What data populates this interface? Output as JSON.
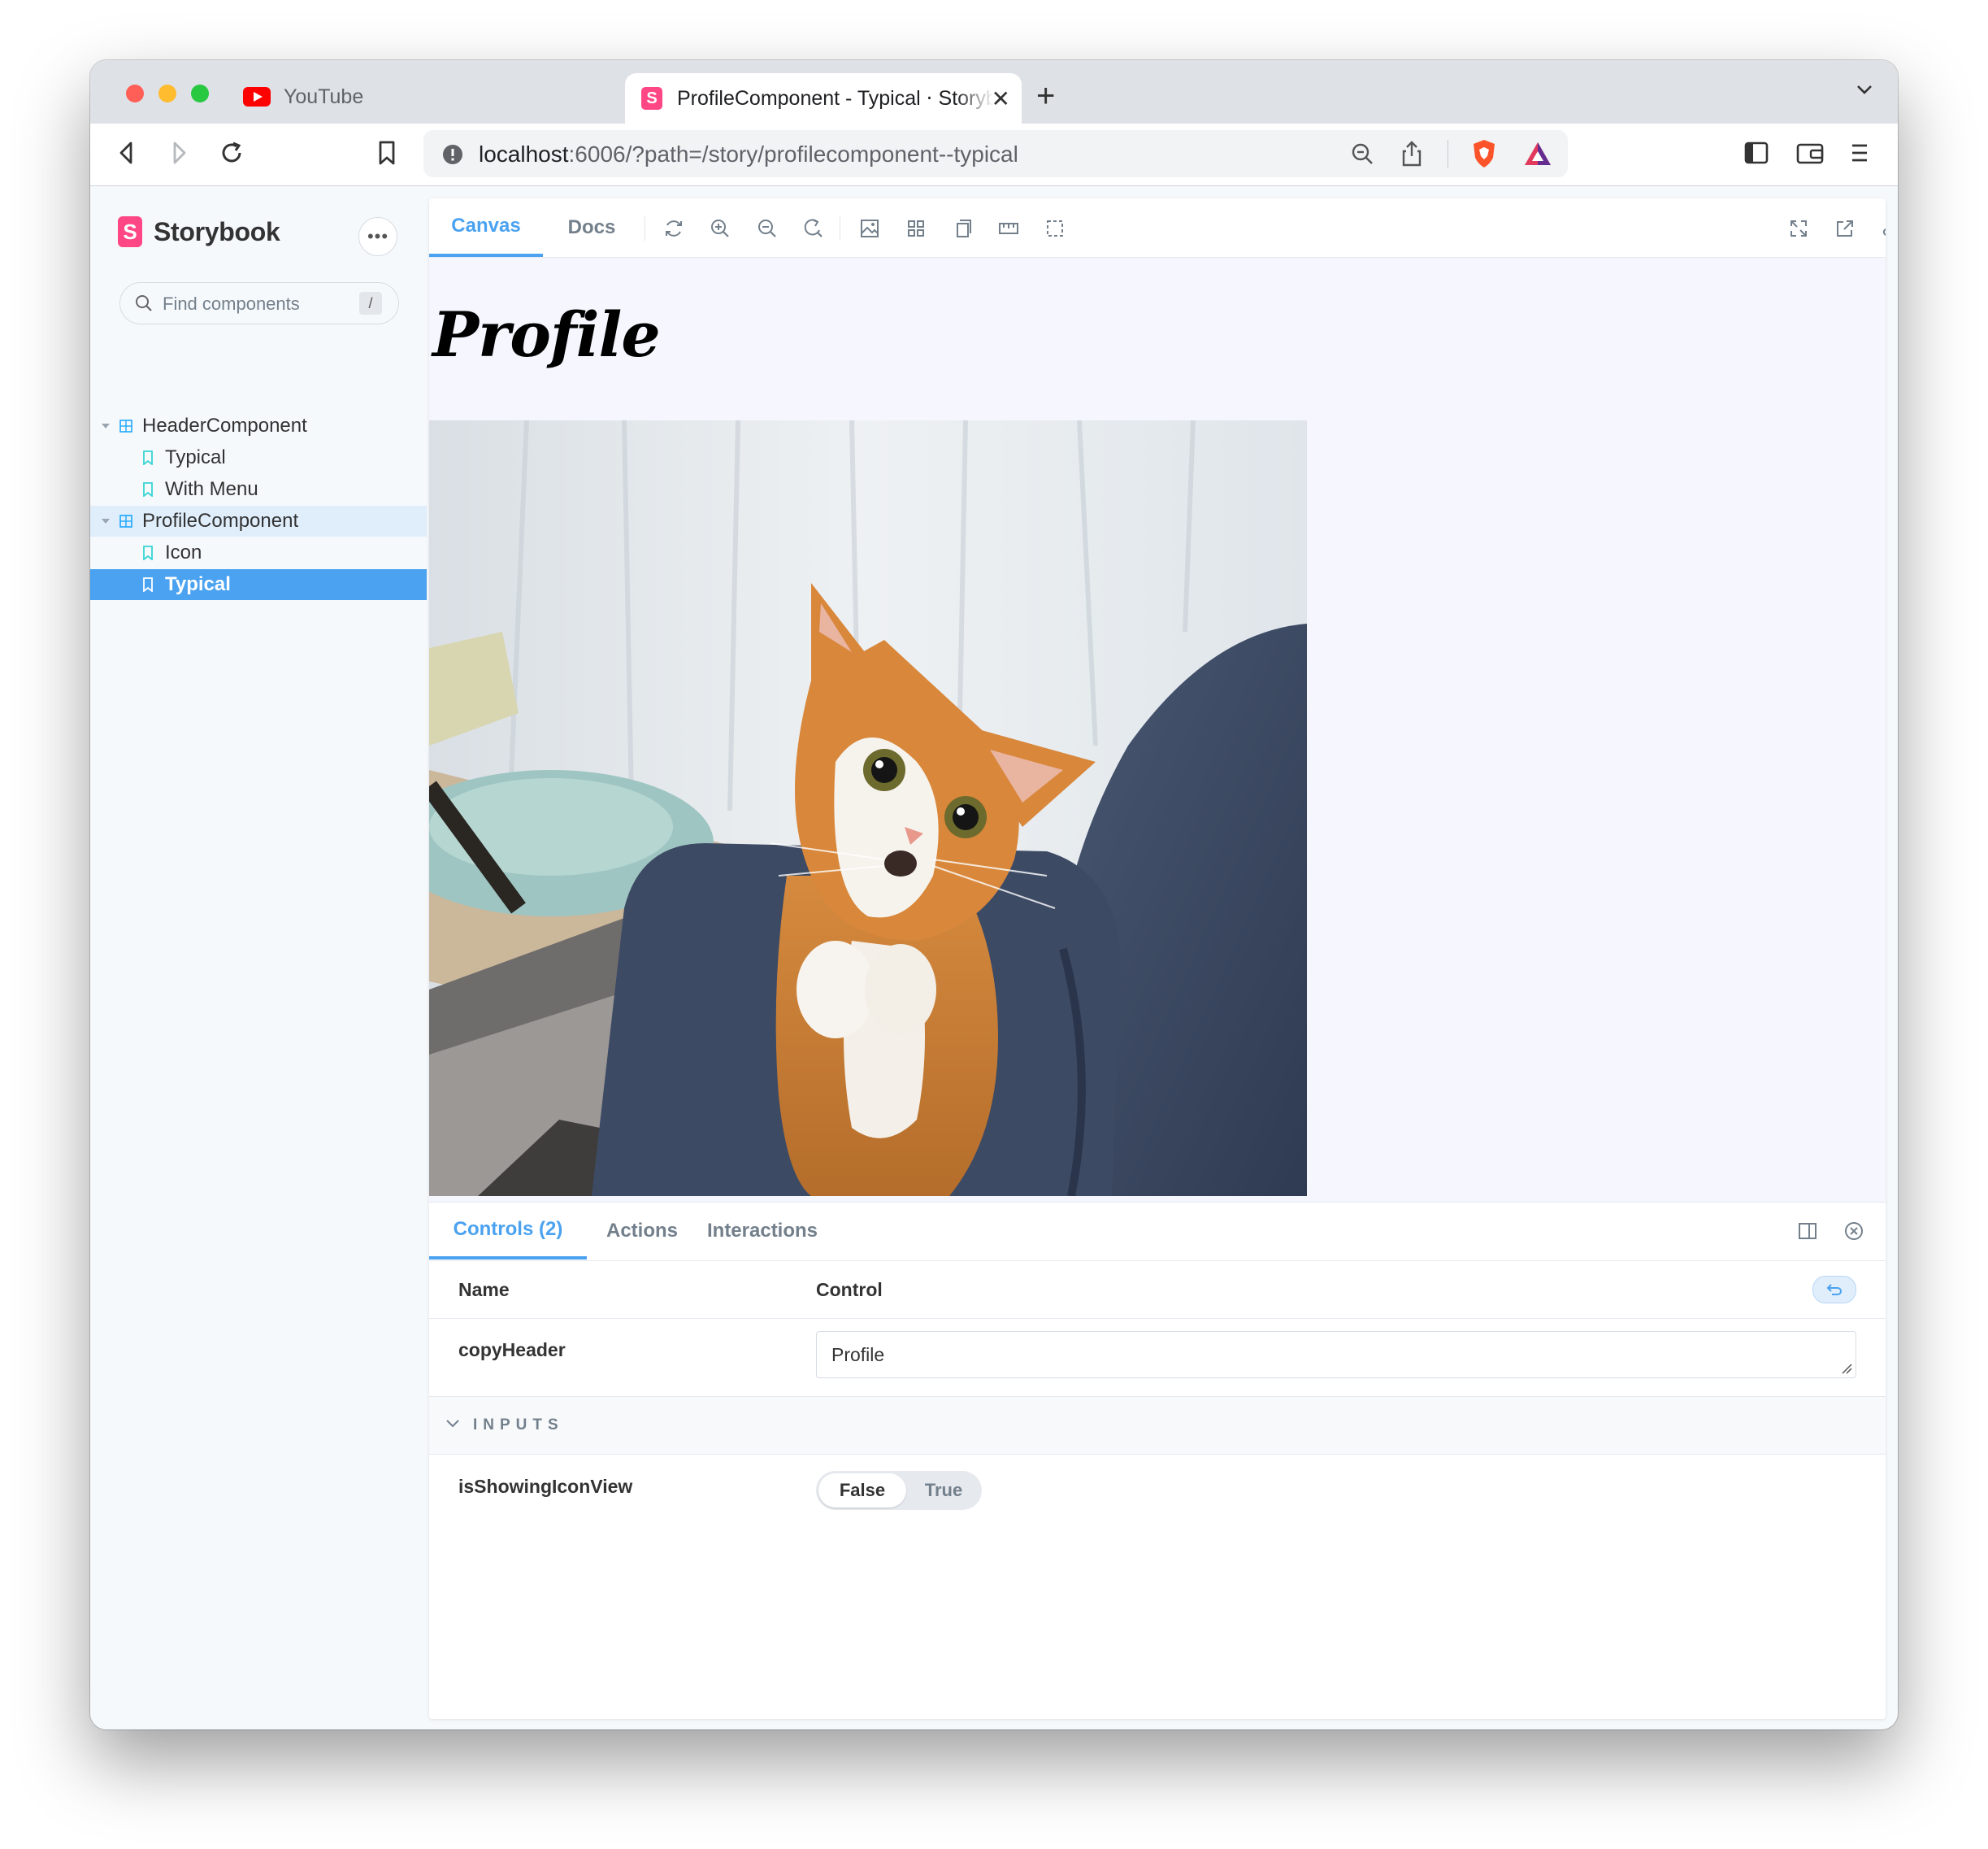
{
  "browser": {
    "tabs": [
      {
        "title": "YouTube",
        "active": false
      },
      {
        "title": "ProfileComponent - Typical ⋅ Storybook",
        "active": true
      }
    ],
    "url_host": "localhost",
    "url_rest": ":6006/?path=/story/profilecomponent--typical"
  },
  "sidebar": {
    "brand": "Storybook",
    "menu_glyph": "•••",
    "search_placeholder": "Find components",
    "search_shortcut": "/",
    "tree": [
      {
        "type": "component",
        "label": "HeaderComponent"
      },
      {
        "type": "story",
        "label": "Typical"
      },
      {
        "type": "story",
        "label": "With Menu"
      },
      {
        "type": "component",
        "label": "ProfileComponent"
      },
      {
        "type": "story",
        "label": "Icon"
      },
      {
        "type": "story",
        "label": "Typical"
      }
    ],
    "selected_story": "Typical"
  },
  "main": {
    "tabs": [
      "Canvas",
      "Docs"
    ],
    "active_tab": "Canvas",
    "preview": {
      "heading": "Profile",
      "image": "orange-white-cat-photo"
    }
  },
  "addons": {
    "tabs": [
      "Controls (2)",
      "Actions",
      "Interactions"
    ],
    "active_tab": "Controls (2)",
    "columns": {
      "name": "Name",
      "control": "Control"
    },
    "controls": [
      {
        "name": "copyHeader",
        "value": "Profile"
      }
    ],
    "section": "INPUTS",
    "inputs": [
      {
        "name": "isShowingIconView",
        "options": [
          "False",
          "True"
        ],
        "selected": "False"
      }
    ]
  },
  "colors": {
    "accent": "#4aa2f0",
    "storybook_pink": "#ff4785",
    "sidebar_bg": "#f6f9fc",
    "canvas_bg": "#f5f6fe"
  }
}
